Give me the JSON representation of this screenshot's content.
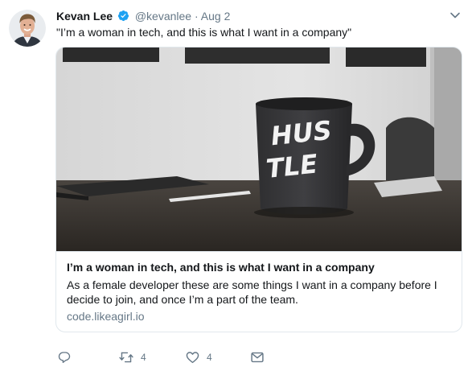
{
  "tweet": {
    "author_name": "Kevan Lee",
    "handle": "@kevanlee",
    "separator": "·",
    "date": "Aug 2",
    "text": "\"I’m a woman in tech, and this is what I want in a company\"",
    "verified": true
  },
  "card": {
    "title": "I’m a woman in tech, and this is what I want in a company",
    "description": "As a female developer these are some things I want in a company before I decide to join, and once I’m a part of the team.",
    "domain": "code.likeagirl.io",
    "image_mug_text_line1": "HUS",
    "image_mug_text_line2": "TLE"
  },
  "actions": {
    "reply_icon": "reply-icon",
    "retweet_icon": "retweet-icon",
    "retweet_count": "4",
    "like_icon": "heart-icon",
    "like_count": "4",
    "dm_icon": "envelope-icon"
  },
  "colors": {
    "text_primary": "#14171a",
    "text_secondary": "#657786",
    "verified_blue": "#1da1f2",
    "border": "#e1e8ed"
  }
}
